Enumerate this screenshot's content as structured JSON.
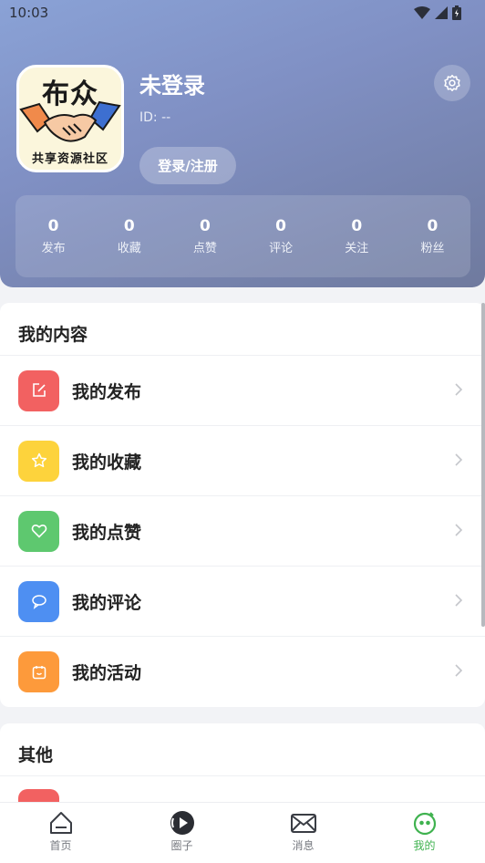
{
  "status_bar": {
    "time": "10:03"
  },
  "profile": {
    "logo": {
      "top_text": "布众",
      "bottom_text": "共享资源社区"
    },
    "username": "未登录",
    "user_id": "ID: --",
    "login_button": "登录/注册"
  },
  "stats": [
    {
      "value": "0",
      "label": "发布"
    },
    {
      "value": "0",
      "label": "收藏"
    },
    {
      "value": "0",
      "label": "点赞"
    },
    {
      "value": "0",
      "label": "评论"
    },
    {
      "value": "0",
      "label": "关注"
    },
    {
      "value": "0",
      "label": "粉丝"
    }
  ],
  "my_content": {
    "title": "我的内容",
    "items": [
      {
        "label": "我的发布",
        "icon": "edit-icon",
        "color": "#f26161"
      },
      {
        "label": "我的收藏",
        "icon": "star-icon",
        "color": "#fdd33c"
      },
      {
        "label": "我的点赞",
        "icon": "heart-icon",
        "color": "#5ec86f"
      },
      {
        "label": "我的评论",
        "icon": "comment-icon",
        "color": "#4e8ff2"
      },
      {
        "label": "我的活动",
        "icon": "calendar-icon",
        "color": "#fd9a3b"
      }
    ]
  },
  "other": {
    "title": "其他"
  },
  "tabbar": {
    "active_color": "#3fb24f",
    "tabs": [
      {
        "label": "首页",
        "icon": "home-icon"
      },
      {
        "label": "圈子",
        "icon": "circle-play-icon"
      },
      {
        "label": "消息",
        "icon": "mail-icon"
      },
      {
        "label": "我的",
        "icon": "profile-face-icon",
        "active": true
      }
    ]
  }
}
